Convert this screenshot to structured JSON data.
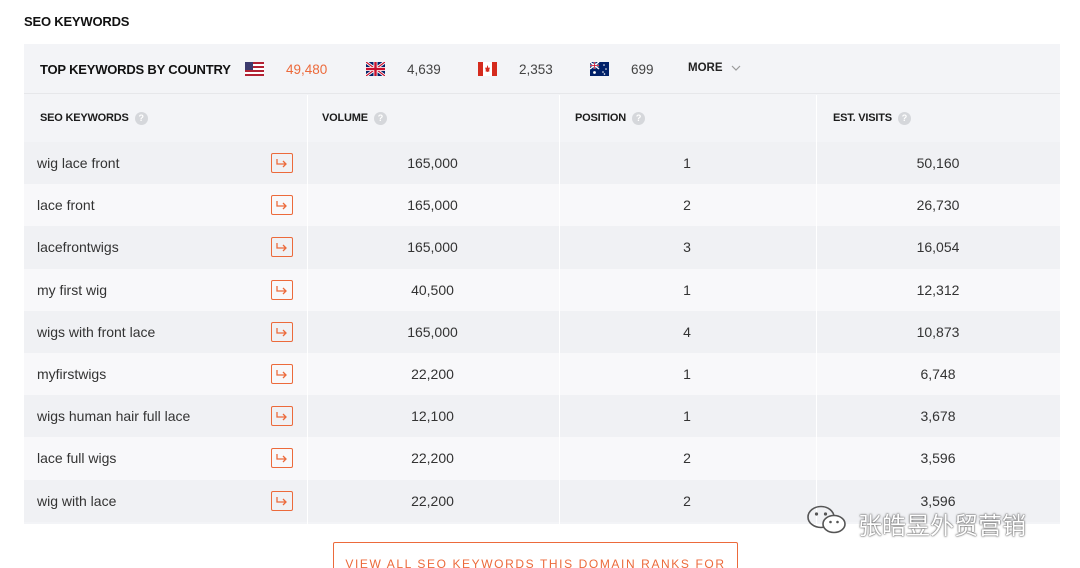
{
  "section_title": "SEO KEYWORDS",
  "country_bar": {
    "title": "TOP KEYWORDS BY COUNTRY",
    "countries": [
      {
        "flag": "us-flag-icon",
        "value": "49,480"
      },
      {
        "flag": "uk-flag-icon",
        "value": "4,639"
      },
      {
        "flag": "canada-flag-icon",
        "value": "2,353"
      },
      {
        "flag": "australia-flag-icon",
        "value": "699"
      }
    ],
    "more_label": "MORE"
  },
  "columns": {
    "keywords": "SEO KEYWORDS",
    "volume": "VOLUME",
    "position": "POSITION",
    "visits": "EST. VISITS"
  },
  "help_glyph": "?",
  "rows": [
    {
      "keyword": "wig lace front",
      "volume": "165,000",
      "position": "1",
      "visits": "50,160"
    },
    {
      "keyword": "lace front",
      "volume": "165,000",
      "position": "2",
      "visits": "26,730"
    },
    {
      "keyword": "lacefrontwigs",
      "volume": "165,000",
      "position": "3",
      "visits": "16,054"
    },
    {
      "keyword": "my first wig",
      "volume": "40,500",
      "position": "1",
      "visits": "12,312"
    },
    {
      "keyword": "wigs with front lace",
      "volume": "165,000",
      "position": "4",
      "visits": "10,873"
    },
    {
      "keyword": "myfirstwigs",
      "volume": "22,200",
      "position": "1",
      "visits": "6,748"
    },
    {
      "keyword": "wigs human hair full lace",
      "volume": "12,100",
      "position": "1",
      "visits": "3,678"
    },
    {
      "keyword": "lace full wigs",
      "volume": "22,200",
      "position": "2",
      "visits": "3,596"
    },
    {
      "keyword": "wig with lace",
      "volume": "22,200",
      "position": "2",
      "visits": "3,596"
    }
  ],
  "view_all_label": "VIEW ALL SEO KEYWORDS THIS DOMAIN RANKS FOR",
  "watermark_text": "张皓昱外贸营销",
  "colors": {
    "accent": "#ec6a3b",
    "panel_bg": "#f3f4f7"
  }
}
